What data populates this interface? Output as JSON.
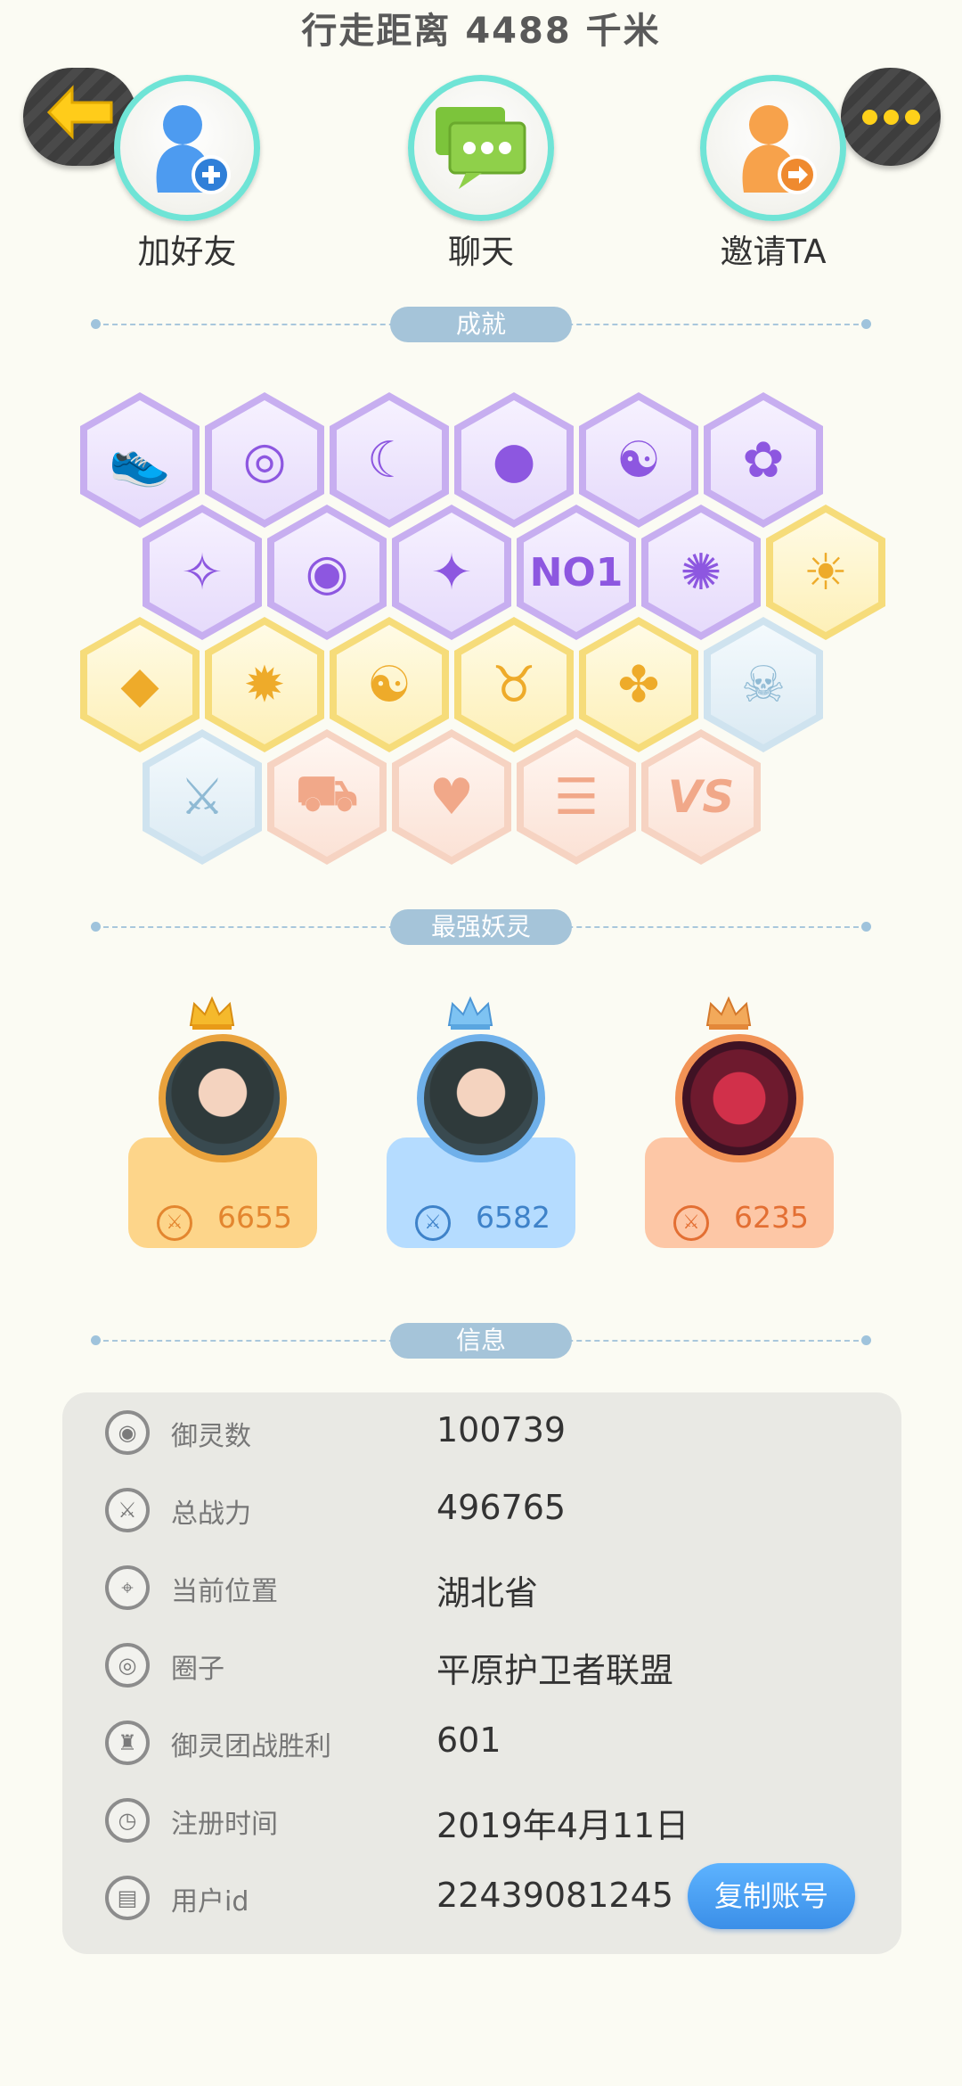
{
  "header": {
    "distance": "行走距离 4488 千米"
  },
  "actions": [
    {
      "label": "加好友",
      "icon": "add-friend-icon"
    },
    {
      "label": "聊天",
      "icon": "chat-icon"
    },
    {
      "label": "邀请TA",
      "icon": "invite-icon"
    }
  ],
  "sections": {
    "achievements": "成就",
    "strongest": "最强妖灵",
    "info": "信息"
  },
  "badges": [
    {
      "icon": "shoe-badge-icon",
      "theme": "purple",
      "glyph": "👟"
    },
    {
      "icon": "lollipop-badge-icon",
      "theme": "purple",
      "glyph": "◎"
    },
    {
      "icon": "devil-moon-badge-icon",
      "theme": "purple",
      "glyph": "☾"
    },
    {
      "icon": "crystal-ball-badge-icon",
      "theme": "purple",
      "glyph": "●"
    },
    {
      "icon": "yin-yang-swirl-badge-icon",
      "theme": "purple",
      "glyph": "☯"
    },
    {
      "icon": "cat-spirit-badge-icon",
      "theme": "purple",
      "glyph": "✿"
    },
    {
      "icon": "fish-badge-icon",
      "theme": "purple",
      "glyph": "✧"
    },
    {
      "icon": "shield-badge-icon",
      "theme": "purple",
      "glyph": "◉"
    },
    {
      "icon": "puzzle-cat-badge-icon",
      "theme": "purple",
      "glyph": "✦"
    },
    {
      "icon": "no1-badge-icon",
      "theme": "purple",
      "glyph": "NO1"
    },
    {
      "icon": "angry-blob-badge-icon",
      "theme": "purple",
      "glyph": "✺"
    },
    {
      "icon": "sun-moon-badge-icon",
      "theme": "gold",
      "glyph": "☀"
    },
    {
      "icon": "golden-egg-badge-icon",
      "theme": "gold",
      "glyph": "◆"
    },
    {
      "icon": "fire-spirit-badge-icon",
      "theme": "gold",
      "glyph": "✹"
    },
    {
      "icon": "taiji-book-badge-icon",
      "theme": "gold",
      "glyph": "☯"
    },
    {
      "icon": "horned-idol-badge-icon",
      "theme": "gold",
      "glyph": "♉"
    },
    {
      "icon": "fox-book-badge-icon",
      "theme": "gold",
      "glyph": "✤"
    },
    {
      "icon": "belt-badge-icon",
      "theme": "ice",
      "glyph": "☠"
    },
    {
      "icon": "crossed-swords-badge-icon",
      "theme": "ice",
      "glyph": "⚔"
    },
    {
      "icon": "cart-badge-icon",
      "theme": "peach",
      "glyph": "⛟"
    },
    {
      "icon": "pets-heart-badge-icon",
      "theme": "peach",
      "glyph": "♥"
    },
    {
      "icon": "fox-list-badge-icon",
      "theme": "peach",
      "glyph": "☰"
    },
    {
      "icon": "vs-badge-icon",
      "theme": "peach",
      "glyph": "VS"
    }
  ],
  "spirits": [
    {
      "power": "6655",
      "rank": "gold"
    },
    {
      "power": "6582",
      "rank": "silver"
    },
    {
      "power": "6235",
      "rank": "bronze"
    }
  ],
  "info": {
    "rows": [
      {
        "key": "御灵数",
        "value": "100739",
        "icon": "spirit-count-icon"
      },
      {
        "key": "总战力",
        "value": "496765",
        "icon": "sword-power-icon"
      },
      {
        "key": "当前位置",
        "value": "湖北省",
        "icon": "location-pin-icon"
      },
      {
        "key": "圈子",
        "value": "平原护卫者联盟",
        "icon": "circle-group-icon"
      },
      {
        "key": "御灵团战胜利",
        "value": "601",
        "icon": "team-battle-icon"
      },
      {
        "key": "注册时间",
        "value": "2019年4月11日",
        "icon": "clock-icon"
      },
      {
        "key": "用户id",
        "value": "22439081245",
        "icon": "user-id-icon"
      }
    ],
    "copy_button": "复制账号"
  },
  "colors": {
    "background": "#fbfbf3",
    "accent_teal": "#6fe4d6",
    "button_blue": "#3b8fe8",
    "divider_pill": "#a5c4d9"
  }
}
